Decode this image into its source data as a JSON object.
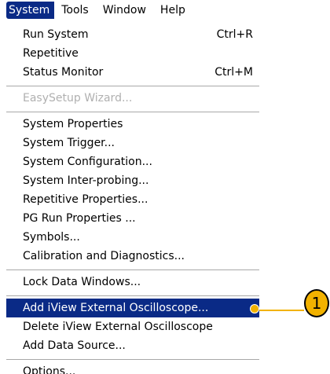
{
  "menubar": {
    "items": [
      {
        "label": "System"
      },
      {
        "label": "Tools"
      },
      {
        "label": "Window"
      },
      {
        "label": "Help"
      }
    ]
  },
  "menu": {
    "items": [
      {
        "label": "Run System",
        "shortcut": "Ctrl+R"
      },
      {
        "label": "Repetitive",
        "shortcut": ""
      },
      {
        "label": "Status Monitor",
        "shortcut": "Ctrl+M"
      },
      {
        "label": "EasySetup Wizard...",
        "shortcut": ""
      },
      {
        "label": "System Properties",
        "shortcut": ""
      },
      {
        "label": "System Trigger...",
        "shortcut": ""
      },
      {
        "label": "System Configuration...",
        "shortcut": ""
      },
      {
        "label": "System Inter-probing...",
        "shortcut": ""
      },
      {
        "label": "Repetitive Properties...",
        "shortcut": ""
      },
      {
        "label": "PG Run Properties ...",
        "shortcut": ""
      },
      {
        "label": "Symbols...",
        "shortcut": ""
      },
      {
        "label": "Calibration and Diagnostics...",
        "shortcut": ""
      },
      {
        "label": "Lock Data Windows...",
        "shortcut": ""
      },
      {
        "label": "Add iView External Oscilloscope...",
        "shortcut": ""
      },
      {
        "label": "Delete iView External Oscilloscope",
        "shortcut": ""
      },
      {
        "label": "Add Data Source...",
        "shortcut": ""
      },
      {
        "label": "Options...",
        "shortcut": ""
      }
    ]
  },
  "callout": {
    "number": "1"
  },
  "colors": {
    "highlight": "#0a2a86",
    "callout": "#f2b200",
    "disabled": "#b0b0b0"
  }
}
